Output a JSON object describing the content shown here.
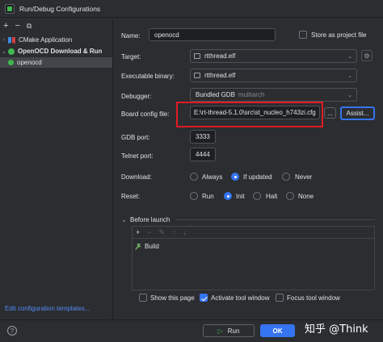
{
  "window": {
    "title": "Run/Debug Configurations"
  },
  "sidebar": {
    "toolbar": [
      "+",
      "−",
      "⧉"
    ],
    "items": [
      {
        "label": "CMake Application",
        "arrow": "›"
      },
      {
        "label": "OpenOCD Download & Run",
        "arrow": "⌄"
      },
      {
        "label": "openocd"
      }
    ],
    "edit_link": "Edit configuration templates..."
  },
  "form": {
    "name_label": "Name:",
    "name_value": "openocd",
    "store_label": "Store as project file",
    "target_label": "Target:",
    "target_value": "rtthread.elf",
    "exec_label": "Executable binary:",
    "exec_value": "rtthread.elf",
    "debugger_label": "Debugger:",
    "debugger_value": "Bundled GDB",
    "debugger_hint": "multiarch",
    "board_label": "Board config file:",
    "board_value": "E:\\rt-thread-5.1.0\\src\\st_nucleo_h743zi.cfg",
    "browse_label": "...",
    "assist_label": "Assist...",
    "gdb_port_label": "GDB port:",
    "gdb_port_value": "3333",
    "telnet_label": "Telnet port:",
    "telnet_value": "4444",
    "download_label": "Download:",
    "download_options": [
      "Always",
      "If updated",
      "Never"
    ],
    "reset_label": "Reset:",
    "reset_options": [
      "Run",
      "Init",
      "Halt",
      "None"
    ]
  },
  "before_launch": {
    "title": "Before launch",
    "toolbar": [
      "+",
      "−",
      "✎",
      "↑",
      "↓"
    ],
    "items": [
      "Build"
    ]
  },
  "footer_checks": {
    "show_page": "Show this page",
    "activate_tool": "Activate tool window",
    "focus_tool": "Focus tool window"
  },
  "buttons": {
    "run": "Run",
    "ok": "OK",
    "help": "?"
  },
  "watermark": "知乎 @Think",
  "colors": {
    "accent": "#3574f0",
    "highlight_box": "#e01b24",
    "link": "#548af7"
  }
}
